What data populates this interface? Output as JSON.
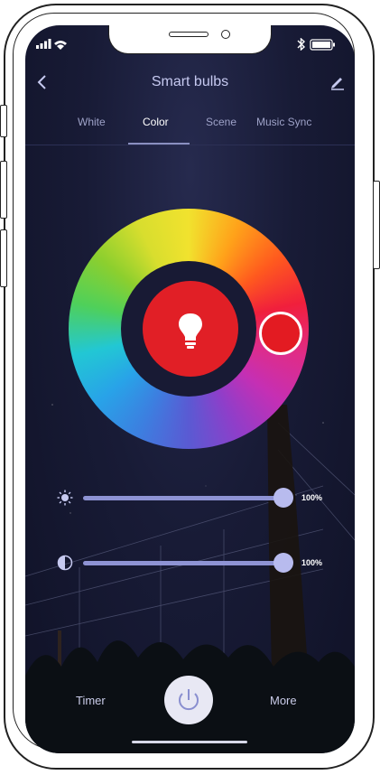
{
  "app": {
    "title": "Smart bulbs"
  },
  "status_bar": {
    "wifi_icon": "wifi-icon",
    "signal_icon": "signal-icon",
    "bluetooth_icon": "bluetooth-icon",
    "battery_icon": "battery-icon"
  },
  "header": {
    "back_icon": "chevron-left-icon",
    "edit_icon": "pencil-icon"
  },
  "tabs": [
    {
      "label": "White",
      "active": false
    },
    {
      "label": "Color",
      "active": true
    },
    {
      "label": "Scene",
      "active": false
    },
    {
      "label": "Music Sync",
      "active": false
    }
  ],
  "color_wheel": {
    "selected_color": "#e31b22",
    "center_icon": "lightbulb-icon"
  },
  "sliders": {
    "brightness": {
      "icon": "sun-icon",
      "value_label": "100%",
      "value": 1.0
    },
    "saturation": {
      "icon": "contrast-icon",
      "value_label": "100%",
      "value": 1.0
    }
  },
  "bottom_bar": {
    "timer_label": "Timer",
    "more_label": "More",
    "power_icon": "power-icon"
  },
  "colors": {
    "accent": "#8e93d4",
    "background": "#181b36",
    "selected": "#e31b22"
  }
}
